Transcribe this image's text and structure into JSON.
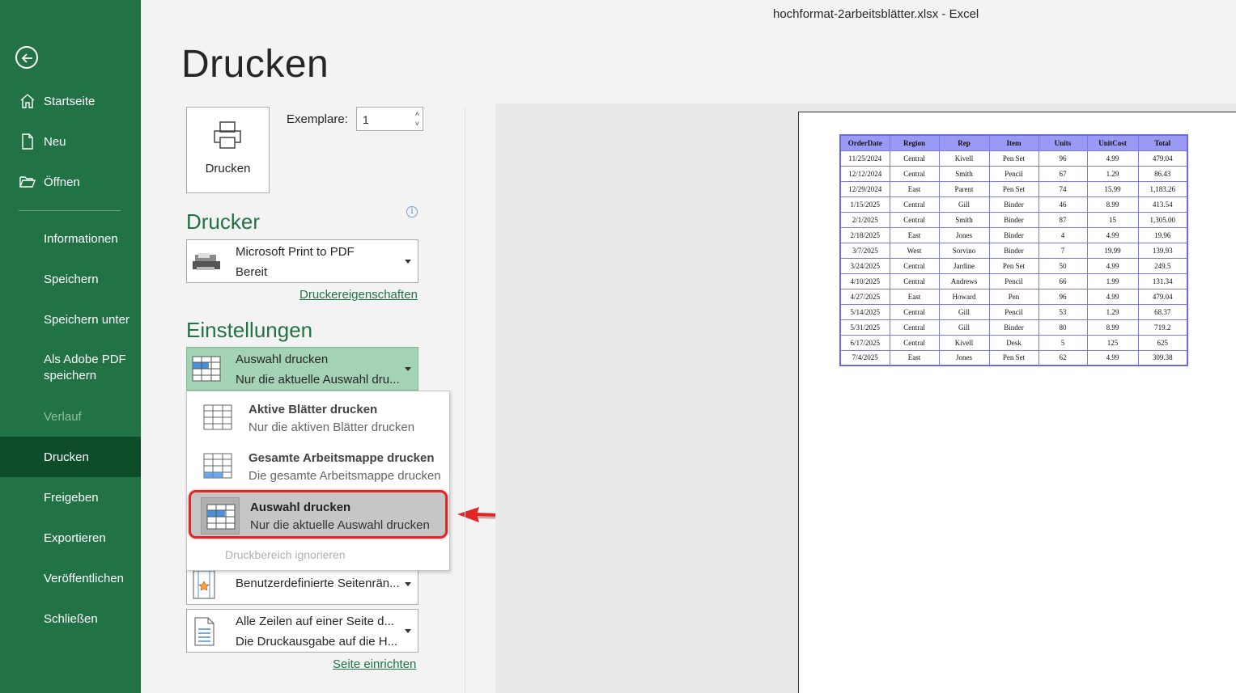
{
  "window_title": "hochformat-2arbeitsblätter.xlsx  -  Excel",
  "sidebar": {
    "items": [
      {
        "label": "Startseite",
        "icon": "home-icon"
      },
      {
        "label": "Neu",
        "icon": "new-file-icon"
      },
      {
        "label": "Öffnen",
        "icon": "open-folder-icon"
      },
      {
        "label": "Informationen"
      },
      {
        "label": "Speichern"
      },
      {
        "label": "Speichern unter"
      },
      {
        "label": "Als Adobe PDF speichern"
      },
      {
        "label": "Verlauf"
      },
      {
        "label": "Drucken"
      },
      {
        "label": "Freigeben"
      },
      {
        "label": "Exportieren"
      },
      {
        "label": "Veröffentlichen"
      },
      {
        "label": "Schließen"
      }
    ]
  },
  "page_title": "Drucken",
  "print_button": {
    "label": "Drucken"
  },
  "copies": {
    "label": "Exemplare:",
    "value": "1"
  },
  "printer": {
    "heading": "Drucker",
    "name": "Microsoft Print to PDF",
    "status": "Bereit",
    "properties_link": "Druckereigenschaften"
  },
  "settings": {
    "heading": "Einstellungen",
    "selected": {
      "title": "Auswahl drucken",
      "subtitle": "Nur die aktuelle Auswahl dru..."
    },
    "menu": [
      {
        "title": "Aktive Blätter drucken",
        "subtitle": "Nur die aktiven Blätter drucken"
      },
      {
        "title": "Gesamte Arbeitsmappe drucken",
        "subtitle": "Die gesamte Arbeitsmappe drucken"
      },
      {
        "title": "Auswahl drucken",
        "subtitle": "Nur die aktuelle Auswahl drucken"
      }
    ],
    "menu_disabled": "Druckbereich ignorieren",
    "margins": {
      "title": "Benutzerdefinierte Seitenrän..."
    },
    "scaling": {
      "title": "Alle Zeilen auf einer Seite d...",
      "subtitle": "Die Druckausgabe auf die H..."
    },
    "page_setup_link": "Seite einrichten"
  },
  "colors": {
    "accent": "#217346",
    "highlight": "#e32526",
    "table_header": "#9a9af5"
  },
  "preview_table": {
    "headers": [
      "OrderDate",
      "Region",
      "Rep",
      "Item",
      "Units",
      "UnitCost",
      "Total"
    ],
    "rows": [
      [
        "11/25/2024",
        "Central",
        "Kivell",
        "Pen Set",
        "96",
        "4.99",
        "479.04"
      ],
      [
        "12/12/2024",
        "Central",
        "Smith",
        "Pencil",
        "67",
        "1.29",
        "86.43"
      ],
      [
        "12/29/2024",
        "East",
        "Parent",
        "Pen Set",
        "74",
        "15.99",
        "1,183.26"
      ],
      [
        "1/15/2025",
        "Central",
        "Gill",
        "Binder",
        "46",
        "8.99",
        "413.54"
      ],
      [
        "2/1/2025",
        "Central",
        "Smith",
        "Binder",
        "87",
        "15",
        "1,305.00"
      ],
      [
        "2/18/2025",
        "East",
        "Jones",
        "Binder",
        "4",
        "4.99",
        "19.96"
      ],
      [
        "3/7/2025",
        "West",
        "Sorvino",
        "Binder",
        "7",
        "19.99",
        "139.93"
      ],
      [
        "3/24/2025",
        "Central",
        "Jardine",
        "Pen Set",
        "50",
        "4.99",
        "249.5"
      ],
      [
        "4/10/2025",
        "Central",
        "Andrews",
        "Pencil",
        "66",
        "1.99",
        "131.34"
      ],
      [
        "4/27/2025",
        "East",
        "Howard",
        "Pen",
        "96",
        "4.99",
        "479.04"
      ],
      [
        "5/14/2025",
        "Central",
        "Gill",
        "Pencil",
        "53",
        "1.29",
        "68.37"
      ],
      [
        "5/31/2025",
        "Central",
        "Gill",
        "Binder",
        "80",
        "8.99",
        "719.2"
      ],
      [
        "6/17/2025",
        "Central",
        "Kivell",
        "Desk",
        "5",
        "125",
        "625"
      ],
      [
        "7/4/2025",
        "East",
        "Jones",
        "Pen Set",
        "62",
        "4.99",
        "309.38"
      ]
    ]
  }
}
